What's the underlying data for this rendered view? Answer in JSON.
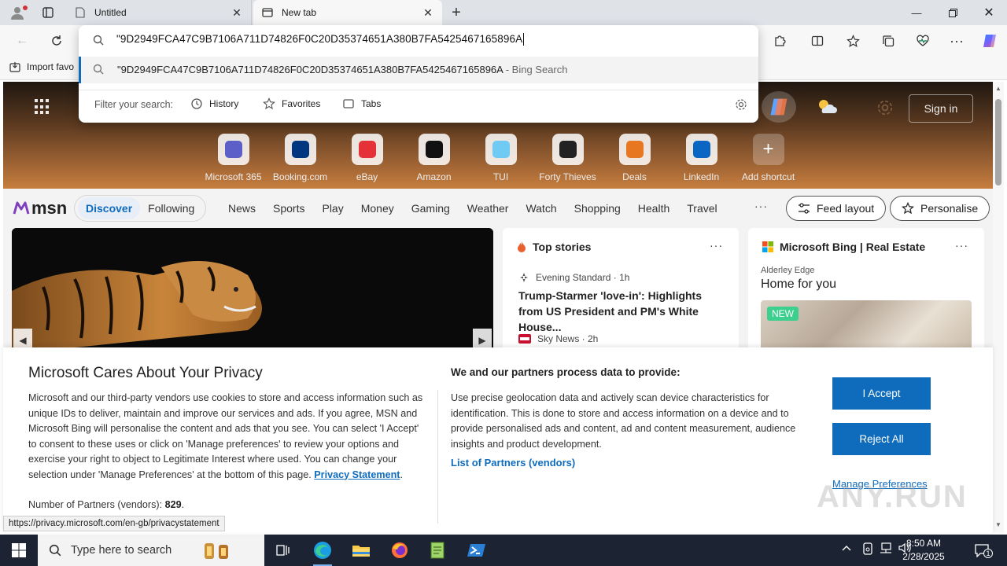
{
  "browser": {
    "tabs": [
      {
        "title": "Untitled",
        "active": false
      },
      {
        "title": "New tab",
        "active": true
      }
    ],
    "bookmark_import": "Import favo"
  },
  "omnibox": {
    "query": "\"9D2949FCA47C9B7106A711D74826F0C20D35374651A380B7FA5425467165896A",
    "suggestion_text": "\"9D2949FCA47C9B7106A711D74826F0C20D35374651A380B7FA5425467165896A",
    "suggestion_suffix": " - Bing Search",
    "filter_label": "Filter your search:",
    "filters": [
      "History",
      "Favorites",
      "Tabs"
    ]
  },
  "hero": {
    "sign_in": "Sign in",
    "shortcuts": [
      {
        "label": "Microsoft 365",
        "icon": "microsoft365-icon",
        "color": "#5b5fc7"
      },
      {
        "label": "Booking.com",
        "icon": "booking-icon",
        "color": "#003580"
      },
      {
        "label": "eBay",
        "icon": "ebay-icon",
        "color": "#e53238"
      },
      {
        "label": "Amazon",
        "icon": "amazon-icon",
        "color": "#111111"
      },
      {
        "label": "TUI",
        "icon": "tui-icon",
        "color": "#70cbf4"
      },
      {
        "label": "Forty Thieves",
        "icon": "forty-thieves-icon",
        "color": "#222222"
      },
      {
        "label": "Deals",
        "icon": "deals-icon",
        "color": "#e87722"
      },
      {
        "label": "LinkedIn",
        "icon": "linkedin-icon",
        "color": "#0a66c2"
      },
      {
        "label": "Add shortcut",
        "icon": "plus-icon",
        "color": "#666666"
      }
    ]
  },
  "msn": {
    "logo": "msn",
    "feed_tabs": [
      "Discover",
      "Following"
    ],
    "nav_links": [
      "News",
      "Sports",
      "Play",
      "Money",
      "Gaming",
      "Weather",
      "Watch",
      "Shopping",
      "Health",
      "Travel"
    ],
    "more": "···",
    "feed_layout": "Feed layout",
    "personalise": "Personalise"
  },
  "top_stories": {
    "title": "Top stories",
    "more": "···",
    "stories": [
      {
        "source": "Evening Standard · 1h",
        "title": "Trump-Starmer 'love-in': Highlights from US President and PM's White House..."
      },
      {
        "source": "Sky News · 2h",
        "title": ""
      }
    ]
  },
  "bing_card": {
    "title": "Microsoft Bing | Real Estate",
    "more": "···",
    "location": "Alderley Edge",
    "headline": "Home for you",
    "badge": "NEW"
  },
  "privacy": {
    "title": "Microsoft Cares About Your Privacy",
    "body": "Microsoft and our third-party vendors use cookies to store and access information such as unique IDs to deliver, maintain and improve our services and ads. If you agree, MSN and Microsoft Bing will personalise the content and ads that you see. You can select 'I Accept' to consent to these uses or click on 'Manage preferences' to review your options and exercise your right to object to Legitimate Interest where used.  You can change your selection under 'Manage Preferences' at the bottom of this page.  ",
    "statement_link": "Privacy Statement",
    "count_label": "Number of Partners (vendors): ",
    "count_value": "829",
    "right_title": "We and our partners process data to provide:",
    "right_body": "Use precise geolocation data and actively scan device characteristics for identification. This is done to store and access information on a device and to provide personalised ads and content, ad and content measurement, audience insights and product development.",
    "partners_link": "List of Partners (vendors)",
    "accept": "I Accept",
    "reject": "Reject All",
    "manage": "Manage Preferences"
  },
  "status_url": "https://privacy.microsoft.com/en-gb/privacystatement",
  "watermark": "ANY.RUN",
  "taskbar": {
    "search_placeholder": "Type here to search",
    "time": "8:50 AM",
    "date": "2/28/2025",
    "notification_count": "1"
  }
}
